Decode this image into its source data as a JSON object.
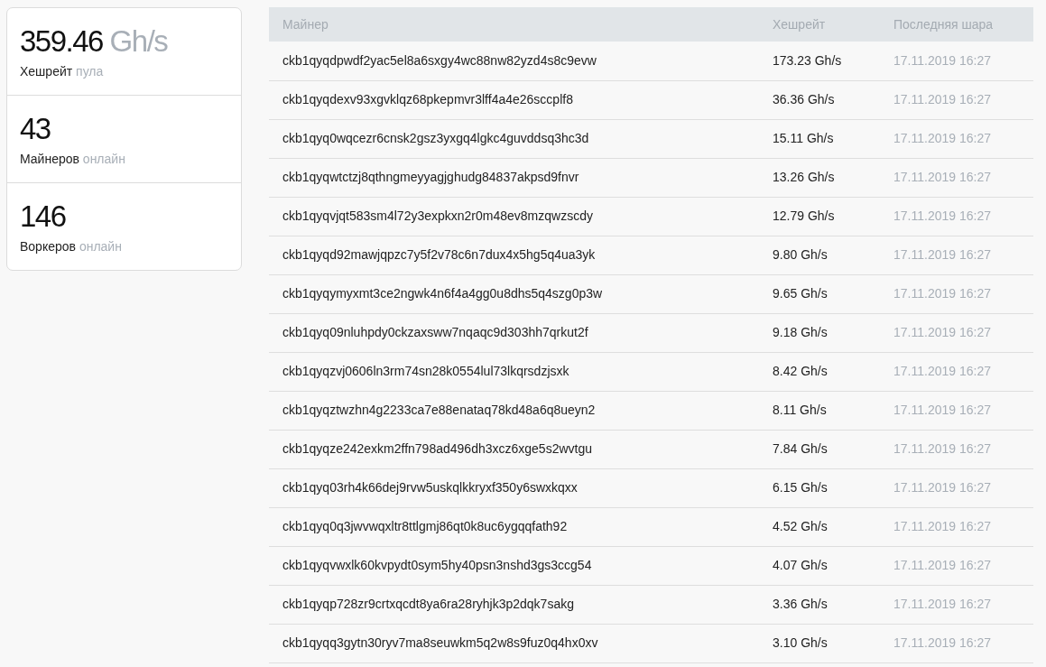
{
  "stats": [
    {
      "value": "359.46",
      "unit": "Gh/s",
      "label": "Хешрейт",
      "label_muted": "пула"
    },
    {
      "value": "43",
      "label": "Майнеров",
      "label_muted": "онлайн"
    },
    {
      "value": "146",
      "label": "Воркеров",
      "label_muted": "онлайн"
    }
  ],
  "table": {
    "columns": [
      "Майнер",
      "Хешрейт",
      "Последняя шара"
    ],
    "rows": [
      [
        "ckb1qyqdpwdf2yac5el8a6sxgy4wc88nw82yzd4s8c9evw",
        "173.23 Gh/s",
        "17.11.2019 16:27"
      ],
      [
        "ckb1qyqdexv93xgvklqz68pkepmvr3lff4a4e26sccplf8",
        "36.36 Gh/s",
        "17.11.2019 16:27"
      ],
      [
        "ckb1qyq0wqcezr6cnsk2gsz3yxgq4lgkc4guvddsq3hc3d",
        "15.11 Gh/s",
        "17.11.2019 16:27"
      ],
      [
        "ckb1qyqwtctzj8qthngmeyyagjghudg84837akpsd9fnvr",
        "13.26 Gh/s",
        "17.11.2019 16:27"
      ],
      [
        "ckb1qyqvjqt583sm4l72y3expkxn2r0m48ev8mzqwzscdy",
        "12.79 Gh/s",
        "17.11.2019 16:27"
      ],
      [
        "ckb1qyqd92mawjqpzc7y5f2v78c6n7dux4x5hg5q4ua3yk",
        "9.80 Gh/s",
        "17.11.2019 16:27"
      ],
      [
        "ckb1qyqymyxmt3ce2ngwk4n6f4a4gg0u8dhs5q4szg0p3w",
        "9.65 Gh/s",
        "17.11.2019 16:27"
      ],
      [
        "ckb1qyq09nluhpdy0ckzaxsww7nqaqc9d303hh7qrkut2f",
        "9.18 Gh/s",
        "17.11.2019 16:27"
      ],
      [
        "ckb1qyqzvj0606ln3rm74sn28k0554lul73lkqrsdzjsxk",
        "8.42 Gh/s",
        "17.11.2019 16:27"
      ],
      [
        "ckb1qyqztwzhn4g2233ca7e88enataq78kd48a6q8ueyn2",
        "8.11 Gh/s",
        "17.11.2019 16:27"
      ],
      [
        "ckb1qyqze242exkm2ffn798ad496dh3xcz6xge5s2wvtgu",
        "7.84 Gh/s",
        "17.11.2019 16:27"
      ],
      [
        "ckb1qyq03rh4k66dej9rvw5uskqlkkryxf350y6swxkqxx",
        "6.15 Gh/s",
        "17.11.2019 16:27"
      ],
      [
        "ckb1qyq0q3jwvwqxltr8ttlgmj86qt0k8uc6ygqqfath92",
        "4.52 Gh/s",
        "17.11.2019 16:27"
      ],
      [
        "ckb1qyqvwxlk60kvpydt0sym5hy40psn3nshd3gs3ccg54",
        "4.07 Gh/s",
        "17.11.2019 16:27"
      ],
      [
        "ckb1qyqp728zr9crtxqcdt8ya6ra28ryhjk3p2dqk7sakg",
        "3.36 Gh/s",
        "17.11.2019 16:27"
      ],
      [
        "ckb1qyqq3gytn30ryv7ma8seuwkm5q2w8s9fuz0q4hx0xv",
        "3.10 Gh/s",
        "17.11.2019 16:27"
      ]
    ]
  }
}
